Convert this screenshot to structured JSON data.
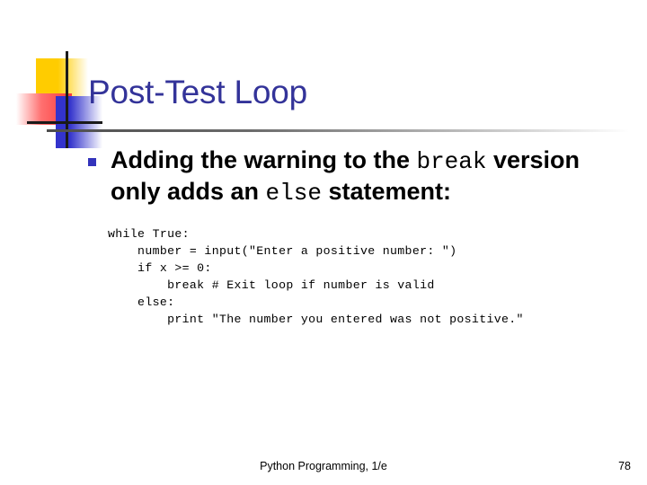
{
  "slide": {
    "title": "Post-Test Loop",
    "title_color": "#333399",
    "accent_colors": {
      "yellow": "#FFCC00",
      "red": "#FA3A3A",
      "blue": "#3333CC",
      "bullet": "#3333BB",
      "rule": "#4d4d4d"
    }
  },
  "bullet": {
    "text_part1": "Adding the warning to the ",
    "keyword1": "break",
    "text_part2": " version only adds an ",
    "keyword2": "else",
    "text_part3": " statement:"
  },
  "code": {
    "lines": [
      "while True:",
      "    number = input(\"Enter a positive number: \")",
      "    if x >= 0:",
      "        break # Exit loop if number is valid",
      "    else:",
      "        print \"The number you entered was not positive.\""
    ],
    "text": "while True:\n    number = input(\"Enter a positive number: \")\n    if x >= 0:\n        break # Exit loop if number is valid\n    else:\n        print \"The number you entered was not positive.\""
  },
  "footer": {
    "source": "Python Programming, 1/e",
    "page_number": "78"
  }
}
